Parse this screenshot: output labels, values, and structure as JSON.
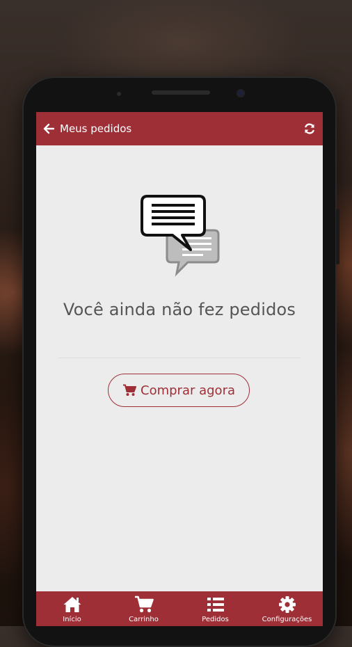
{
  "appbar": {
    "title": "Meus pedidos",
    "back_icon": "arrow-left-icon",
    "refresh_icon": "refresh-icon"
  },
  "empty_state": {
    "icon": "chat-bubbles-icon",
    "message": "Você ainda não fez pedidos",
    "button_label": "Comprar agora",
    "button_icon": "shopping-cart-icon"
  },
  "bottom_nav": {
    "items": [
      {
        "label": "Início",
        "icon": "home-icon"
      },
      {
        "label": "Carrinho",
        "icon": "shopping-cart-icon"
      },
      {
        "label": "Pedidos",
        "icon": "list-icon"
      },
      {
        "label": "Configurações",
        "icon": "gear-icon"
      }
    ]
  },
  "colors": {
    "primary": "#9e2f37",
    "background": "#ececec",
    "text_muted": "#555555"
  }
}
